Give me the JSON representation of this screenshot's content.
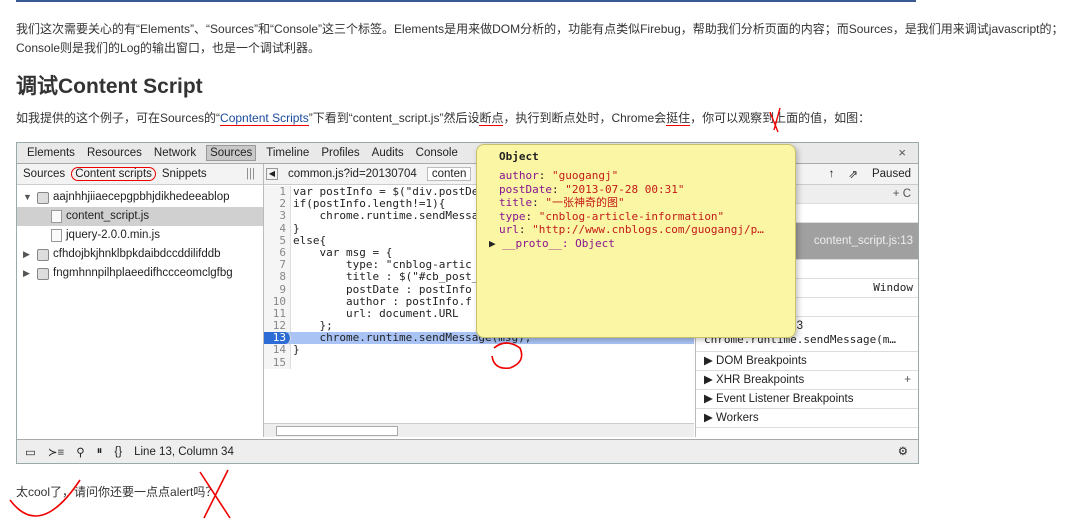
{
  "article": {
    "para1": "我们这次需要关心的有“Elements”、“Sources”和“Console”这三个标签。Elements是用来做DOM分析的，功能有点类似Firebug，帮助我们分析页面的内容；而Sources，是我们用来调试javascript的；Console则是我们的Log的输出窗口，也是一个调试利器。",
    "heading": "调试Content Script",
    "para2_a": "如我提供的这个例子，可在Sources的“",
    "para2_b": "Copntent Scripts",
    "para2_c": "”下看到“content_script.js”然后设",
    "para2_d": "断点",
    "para2_e": "，执行到断点处时，Chrome会",
    "para2_f": "挺住",
    "para2_g": "，你可以观察到上面的值，如图：",
    "para3": "太cool了，请问你还要一点点alert吗？"
  },
  "devtools": {
    "tabs": [
      "Elements",
      "Resources",
      "Network",
      "Sources",
      "Timeline",
      "Profiles",
      "Audits",
      "Console"
    ],
    "active_tab": "Sources",
    "close": "×",
    "left_tabs": [
      "Sources",
      "Content scripts",
      "Snippets"
    ],
    "tree": [
      {
        "label": "aajnhhjiiaecepgpbhjdikhedeeablop",
        "type": "ext",
        "arrow": "▼"
      },
      {
        "label": "content_script.js",
        "type": "file",
        "arrow": ""
      },
      {
        "label": "jquery-2.0.0.min.js",
        "type": "file",
        "arrow": ""
      },
      {
        "label": "cfhdojbkjhnklbpkdaibdccddilifddb",
        "type": "ext",
        "arrow": "▶"
      },
      {
        "label": "fngmhnnpilhplaeedifhccceomclgfbg",
        "type": "ext",
        "arrow": "▶"
      }
    ],
    "file_tabs": [
      "common.js?id=20130704",
      "conten"
    ],
    "code_lines": [
      "var postInfo = $(\"div.postDe",
      "if(postInfo.length!=1){",
      "    chrome.runtime.sendMessa",
      "}",
      "else{",
      "    var msg = {",
      "        type: \"cnblog-artic",
      "        title : $(\"#cb_post_",
      "        postDate : postInfo",
      "        author : postInfo.f",
      "        url: document.URL",
      "    };",
      "    chrome.runtime.sendMessage(msg);",
      "}",
      ""
    ],
    "highlight_line": 13,
    "right_toolbar": [
      "↑",
      "⇗",
      "Paused"
    ],
    "right_rows": [
      {
        "text": "ns",
        "plus": "+  C"
      },
      {
        "text": "",
        "plus": ""
      },
      {
        "text": "content_script.js:13",
        "plus": ""
      },
      {
        "text": "",
        "plus": ""
      },
      {
        "text": "Window",
        "plus": ""
      },
      {
        "text": "",
        "plus": ""
      },
      {
        "text": "content_script.js:13",
        "plus": ""
      },
      {
        "text": "chrome.runtime.sendMessage(m…",
        "plus": ""
      }
    ],
    "sections": [
      {
        "label": "▶ DOM Breakpoints",
        "plus": ""
      },
      {
        "label": "▶ XHR Breakpoints",
        "plus": "+"
      },
      {
        "label": "▶ Event Listener Breakpoints",
        "plus": ""
      },
      {
        "label": "▶ Workers",
        "plus": ""
      }
    ],
    "status": {
      "position": "Line 13, Column 34",
      "icons": [
        "dock-icon",
        "console-icon",
        "search-icon",
        "pause-icon",
        "format-icon"
      ]
    }
  },
  "popup": {
    "title": "Object",
    "rows": [
      {
        "key": "author",
        "val": "\"guogangj\""
      },
      {
        "key": "postDate",
        "val": "\"2013-07-28 00:31\""
      },
      {
        "key": "title",
        "val": "\"一张神奇的图\""
      },
      {
        "key": "type",
        "val": "\"cnblog-article-information\""
      },
      {
        "key": "url",
        "val": "\"http://www.cnblogs.com/guogangj/p…"
      }
    ],
    "proto": "__proto__: Object"
  }
}
